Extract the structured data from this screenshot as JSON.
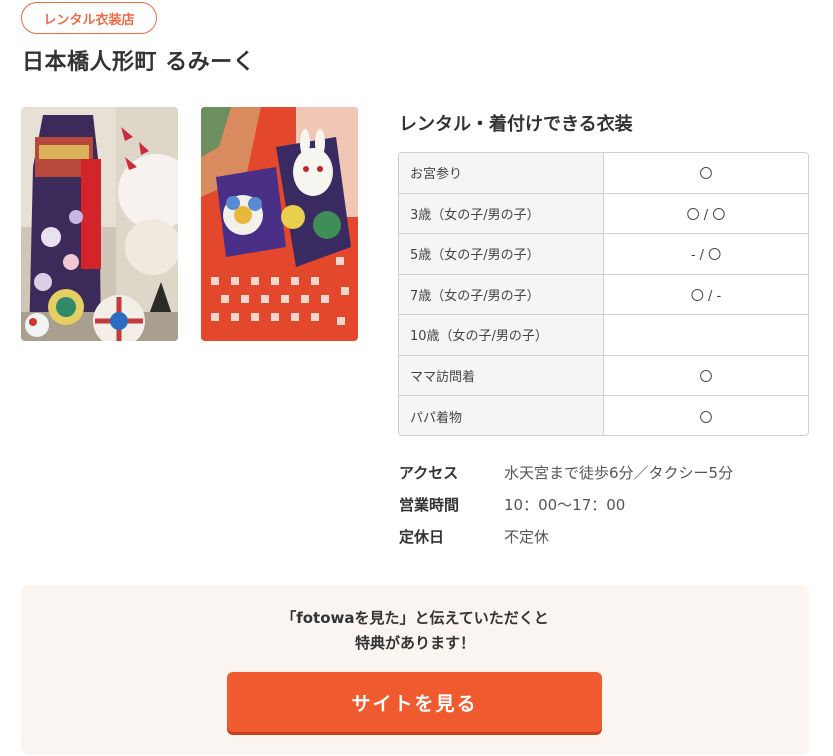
{
  "badge": "レンタル衣装店",
  "shop_name": "日本橋人形町 るみーく",
  "costume_heading": "レンタル・着付けできる衣装",
  "costumes": [
    {
      "name": "お宮参り",
      "value": "〇"
    },
    {
      "name": "3歳（女の子/男の子）",
      "value": "〇 / 〇"
    },
    {
      "name": "5歳（女の子/男の子）",
      "value": "- / 〇"
    },
    {
      "name": "7歳（女の子/男の子）",
      "value": "〇 / -"
    },
    {
      "name": "10歳（女の子/男の子）",
      "value": ""
    },
    {
      "name": "ママ訪問着",
      "value": "〇"
    },
    {
      "name": "パパ着物",
      "value": "〇"
    }
  ],
  "info": {
    "access_label": "アクセス",
    "access_value": "水天宮まで徒歩6分／タクシー5分",
    "hours_label": "営業時間",
    "hours_value": "10：00〜17：00",
    "holiday_label": "定休日",
    "holiday_value": "不定休"
  },
  "cta": {
    "line1": "「fotowaを見た」と伝えていただくと",
    "line2": "特典があります！",
    "button_label": "サイトを見る"
  },
  "colors": {
    "accent": "#f05a2f",
    "badge": "#ef6a45",
    "cta_bg": "#faf5f1",
    "table_label_bg": "#f5f5f5"
  }
}
